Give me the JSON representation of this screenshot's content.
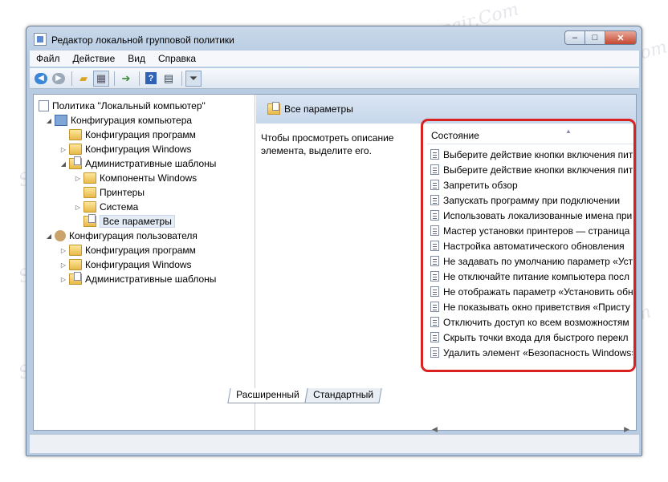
{
  "window": {
    "title": "Редактор локальной групповой политики"
  },
  "menu": [
    "Файл",
    "Действие",
    "Вид",
    "Справка"
  ],
  "tree": [
    {
      "label": "Политика \"Локальный компьютер\"",
      "icon": "policy-icon"
    },
    {
      "label": "Конфигурация компьютера",
      "icon": "computer-icon"
    },
    {
      "label": "Конфигурация программ",
      "icon": "folder-icon"
    },
    {
      "label": "Конфигурация Windows",
      "icon": "folder-icon"
    },
    {
      "label": "Административные шаблоны",
      "icon": "folder-icon"
    },
    {
      "label": "Компоненты Windows",
      "icon": "folder-icon"
    },
    {
      "label": "Принтеры",
      "icon": "folder-icon"
    },
    {
      "label": "Система",
      "icon": "folder-icon"
    },
    {
      "label": "Все параметры",
      "icon": "all-settings-icon",
      "selected": true
    },
    {
      "label": "Конфигурация пользователя",
      "icon": "user-icon"
    },
    {
      "label": "Конфигурация программ",
      "icon": "folder-icon"
    },
    {
      "label": "Конфигурация Windows",
      "icon": "folder-icon"
    },
    {
      "label": "Административные шаблоны",
      "icon": "folder-icon"
    }
  ],
  "right": {
    "header": "Все параметры",
    "description": "Чтобы просмотреть описание элемента, выделите его.",
    "column_header": "Состояние",
    "items": [
      "Выберите действие кнопки включения пит",
      "Выберите действие кнопки включения пит",
      "Запретить обзор",
      "Запускать программу при подключении",
      "Использовать локализованные имена при",
      "Мастер установки принтеров — страница",
      "Настройка автоматического обновления",
      "Не задавать по умолчанию параметр «Уст",
      "Не отключайте питание компьютера посл",
      "Не отображать параметр «Установить обн",
      "Не показывать окно приветствия «Присту",
      "Отключить доступ ко всем возможностям",
      "Скрыть точки входа для быстрого перекл",
      "Удалить элемент «Безопасность Windows»"
    ]
  },
  "tabs": [
    "Расширенный",
    "Стандартный"
  ],
  "watermark": "Soringpcrepair.Com",
  "colors": {
    "highlight": "#d9211f",
    "accent": "#3a86d8"
  }
}
